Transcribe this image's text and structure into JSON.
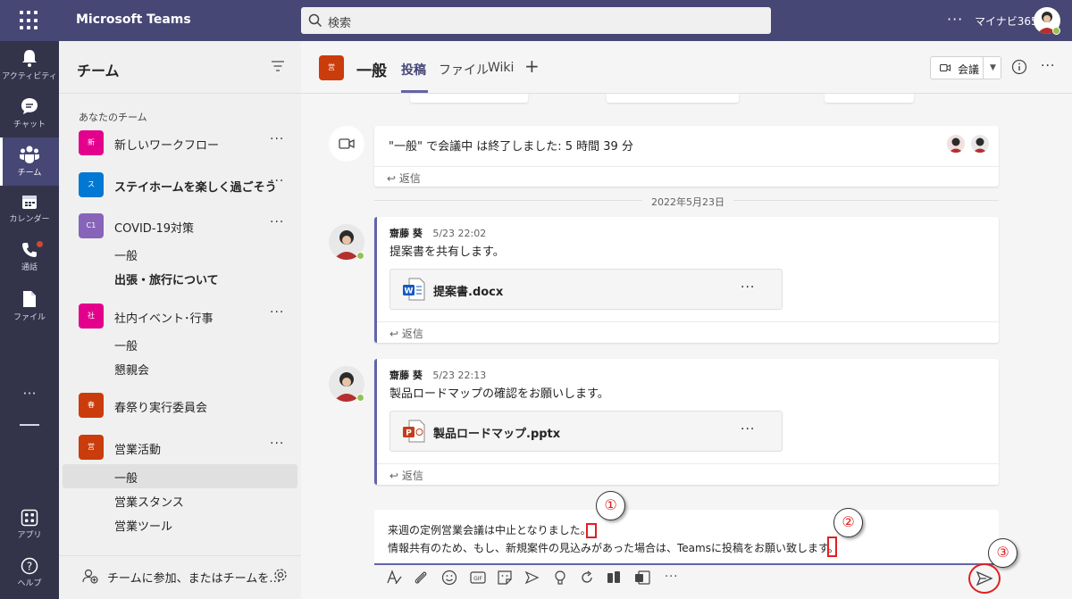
{
  "app": {
    "title": "Microsoft Teams",
    "search_placeholder": "検索",
    "more": "···",
    "user_name": "マイナビ365"
  },
  "rail": {
    "items": [
      {
        "label": "アクティビティ",
        "icon": "bell-icon"
      },
      {
        "label": "チャット",
        "icon": "chat-icon"
      },
      {
        "label": "チーム",
        "icon": "teams-icon"
      },
      {
        "label": "カレンダー",
        "icon": "calendar-icon"
      },
      {
        "label": "通話",
        "icon": "phone-icon"
      },
      {
        "label": "ファイル",
        "icon": "file-icon"
      }
    ],
    "more": "···",
    "apps_label": "アプリ",
    "help_label": "ヘルプ"
  },
  "sidebar": {
    "title": "チーム",
    "section": "あなたのチーム",
    "teams": [
      {
        "tile": "新",
        "name": "新しいワークフロー",
        "color": "#e3008c",
        "bold": false,
        "more": "···"
      },
      {
        "tile": "ス",
        "name": "ステイホームを楽しく過ごそう",
        "color": "#0078d4",
        "bold": true,
        "more": "···"
      },
      {
        "tile": "C1",
        "name": "COVID-19対策",
        "color": "#8764b8",
        "bold": false,
        "more": "···"
      },
      {
        "tile": "社",
        "name": "社内イベント･行事",
        "color": "#e3008c",
        "bold": false,
        "more": "···"
      },
      {
        "tile": "春",
        "name": "春祭り実行委員会",
        "color": "#ca3c0b",
        "bold": false,
        "more": ""
      },
      {
        "tile": "営",
        "name": "営業活動",
        "color": "#ca3c0b",
        "bold": false,
        "more": "···"
      }
    ],
    "channels": {
      "covid": [
        "一般",
        "出張・旅行について"
      ],
      "event": [
        "一般",
        "懇親会"
      ],
      "sales": [
        "一般",
        "営業スタンス",
        "営業ツール"
      ]
    },
    "join_label": "チームに参加、またはチームを…"
  },
  "channel_header": {
    "tile": "営",
    "name": "一般",
    "tabs": [
      "投稿",
      "ファイル",
      "Wiki"
    ],
    "plus": "+",
    "meet_label": "会議",
    "more": "···"
  },
  "feed": {
    "meeting_text": "\"一般\" で会議中 は終了しました: 5 時間 39 分",
    "reply_label": "返信",
    "date_label": "2022年5月23日",
    "messages": [
      {
        "sender": "齋藤 葵",
        "time": "5/23 22:02",
        "body": "提案書を共有します。",
        "file": "提案書.docx",
        "file_icon": "word-icon",
        "file_color": "#185abd",
        "file_more": "···"
      },
      {
        "sender": "齋藤 葵",
        "time": "5/23 22:13",
        "body": "製品ロードマップの確認をお願いします。",
        "file": "製品ロードマップ.pptx",
        "file_icon": "powerpoint-icon",
        "file_color": "#c43e1c",
        "file_more": "···"
      }
    ]
  },
  "compose": {
    "line1": "来週の定例営業会議は中止となりました。",
    "line2": "情報共有のため、もし、新規案件の見込みがあった場合は、Teamsに投稿をお願い致します。",
    "more": "···"
  },
  "callouts": [
    "①",
    "②",
    "③"
  ],
  "colors": {
    "brand": "#464775",
    "accent": "#6264a7",
    "annotation": "#e02020",
    "online": "#92c353"
  }
}
